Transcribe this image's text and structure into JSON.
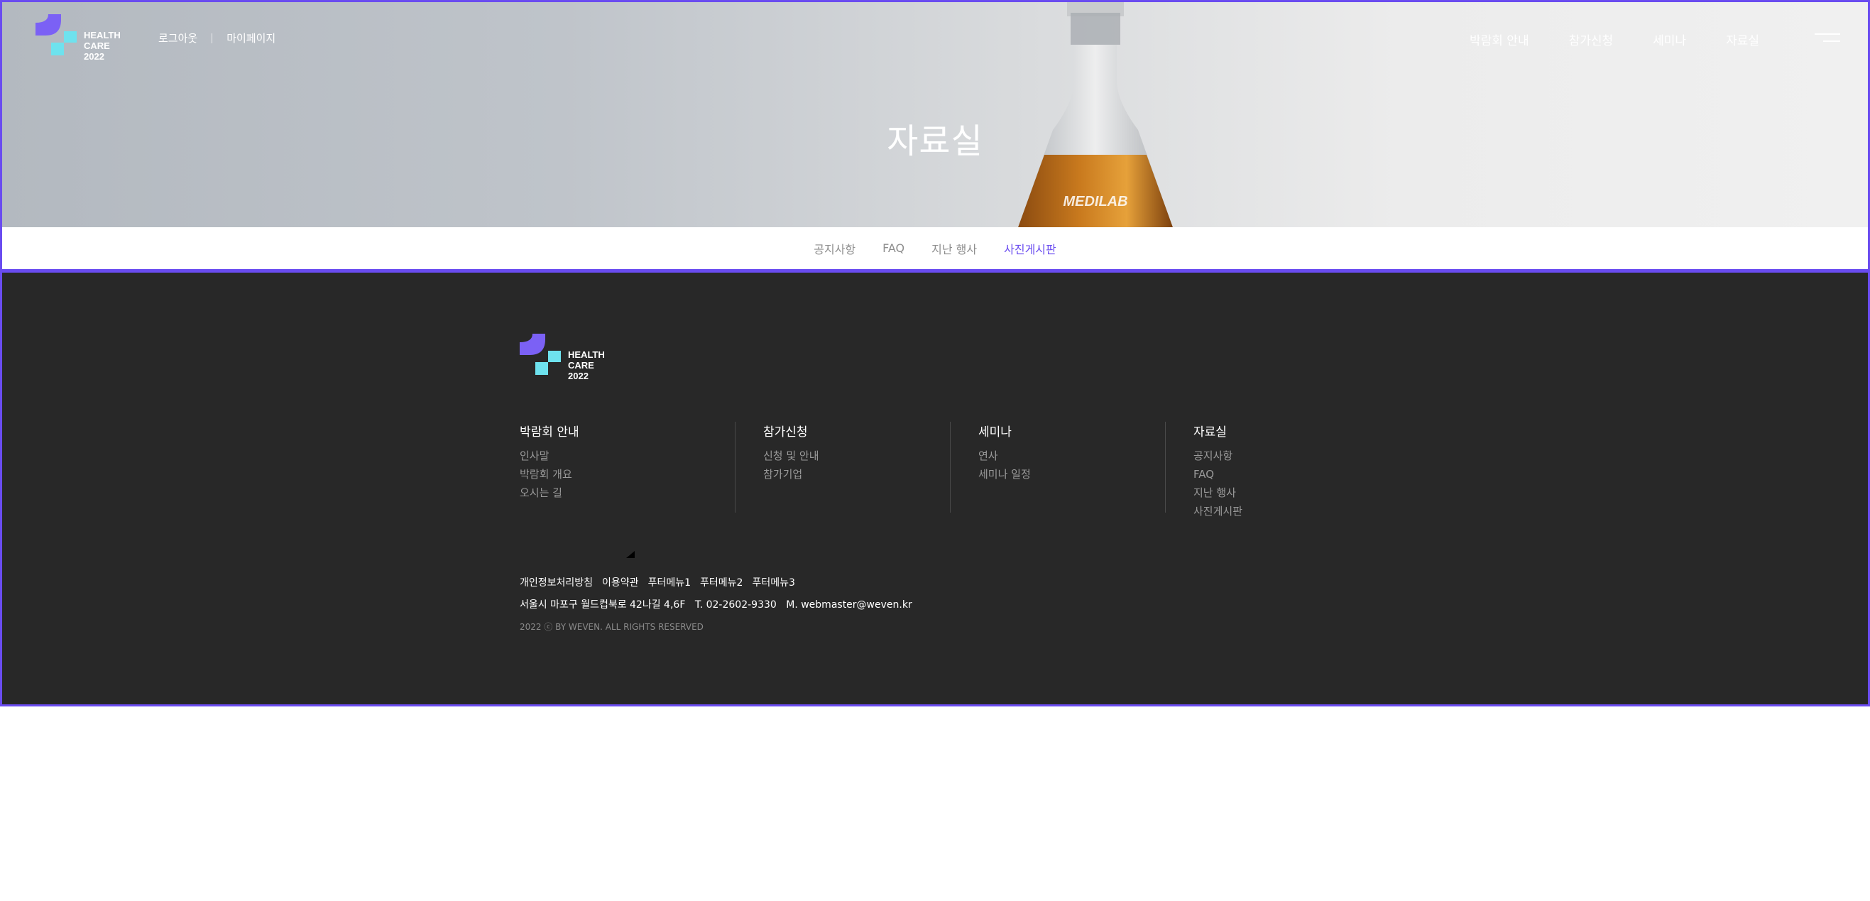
{
  "header": {
    "logo_text": [
      "HEALTH",
      "CARE",
      "2022"
    ],
    "top_links": [
      "로그아웃",
      "마이페이지"
    ],
    "nav": [
      "박람회 안내",
      "참가신청",
      "세미나",
      "자료실"
    ],
    "menu_icon": "hamburger-icon"
  },
  "hero": {
    "title": "자료실",
    "flask_label": "MEDILAB"
  },
  "subnav": {
    "items": [
      "공지사항",
      "FAQ",
      "지난 행사",
      "사진게시판"
    ],
    "active": "사진게시판"
  },
  "footer": {
    "logo_text": [
      "HEALTH",
      "CARE",
      "2022"
    ],
    "columns": [
      {
        "title": "박람회 안내",
        "items": [
          "인사말",
          "박람회 개요",
          "오시는 길"
        ]
      },
      {
        "title": "참가신청",
        "items": [
          "신청 및 안내",
          "참가기업"
        ]
      },
      {
        "title": "세미나",
        "items": [
          "연사",
          "세미나 일정"
        ]
      },
      {
        "title": "자료실",
        "items": [
          "공지사항",
          "FAQ",
          "지난 행사",
          "사진게시판"
        ]
      }
    ],
    "policy_links": [
      "개인정보처리방침",
      "이용약관",
      "푸터메뉴1",
      "푸터메뉴2",
      "푸터메뉴3"
    ],
    "address": "서울시 마포구 월드컵북로 42나길 4,6F",
    "phone": "T. 02-2602-9330",
    "email": "M. webmaster@weven.kr",
    "copyright": "2022 ⓒ BY WEVEN. ALL RIGHTS RESERVED"
  },
  "colors": {
    "accent": "#6a4cf0",
    "logo_purple": "#7b61f5",
    "logo_cyan": "#6ee2ee",
    "footer_bg": "#282828"
  }
}
